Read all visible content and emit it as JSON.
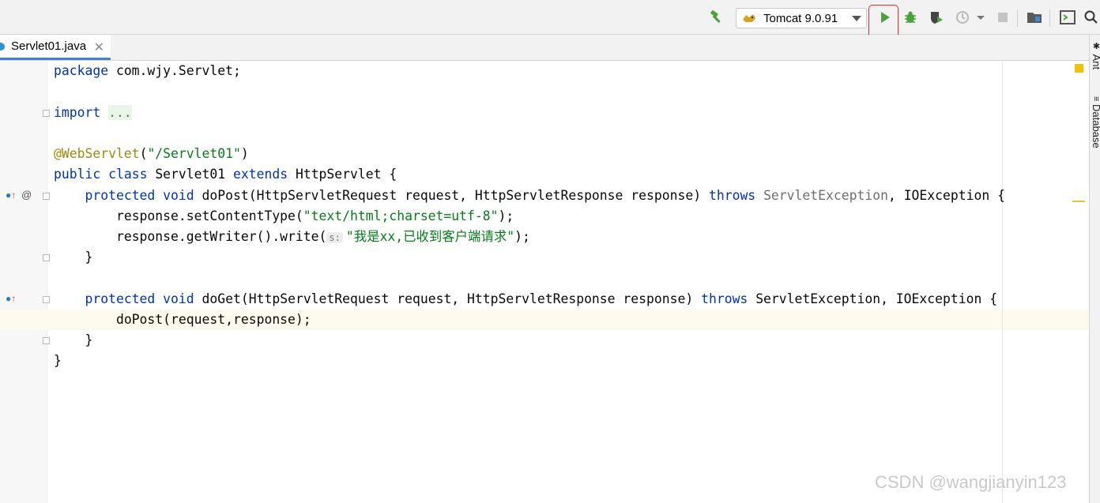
{
  "toolbar": {
    "build_icon": "hammer-icon",
    "run_config": "Tomcat 9.0.91",
    "run_config_icon": "tomcat-icon",
    "run_icon": "play-icon",
    "debug_icon": "bug-icon",
    "coverage_icon": "shield-run-icon",
    "profile_icon": "profiler-icon",
    "stop_icon": "stop-icon",
    "project_structure_icon": "folder-icon",
    "terminal_icon": "window-icon",
    "search_icon": "search-icon",
    "accent": "#4aa23a",
    "highlight_color": "#e02b2b"
  },
  "tabs": [
    {
      "label": "Servlet01.java",
      "active": true
    }
  ],
  "right_panels": [
    "Ant",
    "Database"
  ],
  "code": {
    "package_kw": "package",
    "package_name": " com.wjy.Servlet;",
    "import_kw": "import",
    "import_fold": "...",
    "annotation": "@WebServlet",
    "annotation_open": "(",
    "annotation_value": "\"/Servlet01\"",
    "annotation_close": ")",
    "class_kw1": "public",
    "class_kw2": "class",
    "class_name": "Servlet01",
    "extends_kw": "extends",
    "super_class": "HttpServlet {",
    "m1_mod": "protected",
    "m1_void": "void",
    "m1_sig": "doPost(HttpServletRequest request, HttpServletResponse response)",
    "m1_throws": "throws",
    "m1_ex1": "ServletException",
    "m1_ex2": ", IOException {",
    "m1_l1_a": "response.setContentType(",
    "m1_l1_str": "\"text/html;charset=utf-8\"",
    "m1_l1_b": ");",
    "m1_l2_a": "response.getWriter().write(",
    "m1_l2_hint": "s:",
    "m1_l2_str": "\"我是xx,已收到客户端请求\"",
    "m1_l2_b": ");",
    "m1_close": "}",
    "m2_mod": "protected",
    "m2_void": "void",
    "m2_sig": "doGet(HttpServletRequest request, HttpServletResponse response)",
    "m2_throws": "throws",
    "m2_ex": "ServletException, IOException {",
    "m2_l1": "doPost(request,response);",
    "m2_close": "}",
    "class_close": "}"
  },
  "watermark": "CSDN @wangjianyin123"
}
